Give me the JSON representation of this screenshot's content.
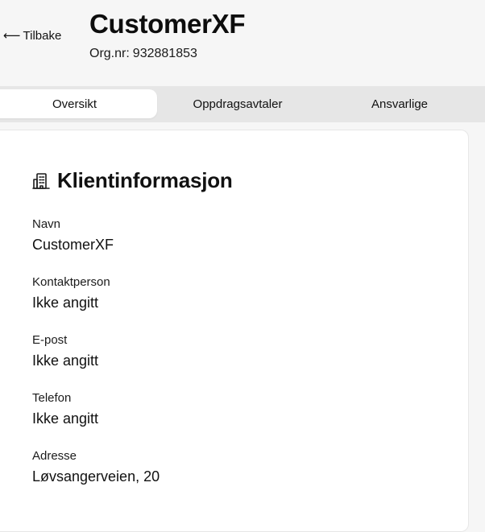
{
  "header": {
    "back_label": "Tilbake",
    "back_arrow": "⟵",
    "client_name": "CustomerXF",
    "org_label": "Org.nr:",
    "org_number": "932881853"
  },
  "tabs": [
    {
      "label": "Oversikt",
      "active": true
    },
    {
      "label": "Oppdragsavtaler",
      "active": false
    },
    {
      "label": "Ansvarlige",
      "active": false
    }
  ],
  "card": {
    "icon": "office-building-icon",
    "title": "Klientinformasjon",
    "fields": [
      {
        "label": "Navn",
        "value": "CustomerXF"
      },
      {
        "label": "Kontaktperson",
        "value": "Ikke angitt"
      },
      {
        "label": "E-post",
        "value": "Ikke angitt"
      },
      {
        "label": "Telefon",
        "value": "Ikke angitt"
      },
      {
        "label": "Adresse",
        "value": "Løvsangerveien, 20"
      }
    ]
  },
  "colors": {
    "page_background": "#f6f6f6",
    "tabs_background": "#e6e6e6",
    "card_background": "#ffffff",
    "text": "#111111"
  }
}
